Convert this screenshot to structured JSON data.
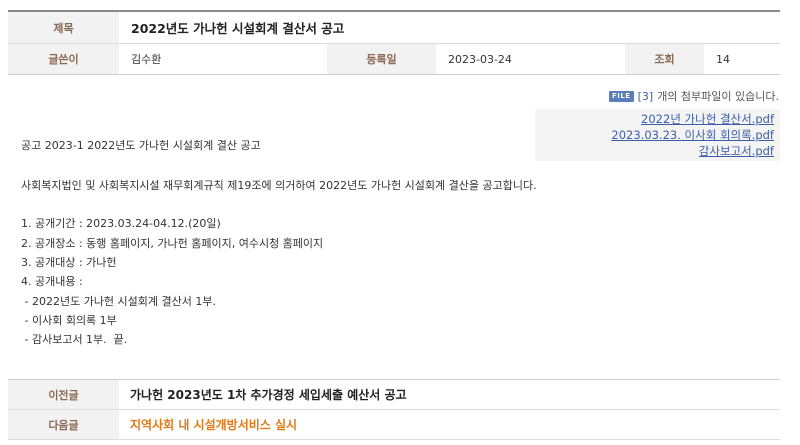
{
  "meta": {
    "title_label": "제목",
    "title": "2022년도 가나헌 시설회계 결산서 공고",
    "author_label": "글쓴이",
    "author": "김수환",
    "date_label": "등록일",
    "date": "2023-03-24",
    "views_label": "조회",
    "views": "14"
  },
  "attachments": {
    "badge": "FILE",
    "count": "[3]",
    "count_suffix": "개의 첨부파일이 있습니다.",
    "files": [
      "2022년 가나헌 결산서.pdf",
      "2023.03.23. 이사회 회의록.pdf",
      "감사보고서.pdf"
    ]
  },
  "content": {
    "lines": [
      "공고 2023-1 2022년도 가나헌 시설회계 결산 공고",
      "사회복지법인 및 사회복지시설 재무회계규칙 제19조에 의거하여 2022년도 가나헌 시설회계 결산을 공고합니다.",
      "1. 공개기간 : 2023.03.24-04.12.(20일)",
      "2. 공개장소 : 동행 홈페이지, 가나헌 홈페이지, 여수시청 홈페이지",
      "3. 공개대상 : 가나헌",
      "4. 공개내용 :",
      " - 2022년도 가나헌 시설회계 결산서 1부.",
      " - 이사회 회의록 1부",
      " - 감사보고서 1부.  끝."
    ]
  },
  "nav": {
    "prev_label": "이전글",
    "prev_title": "가나헌 2023년도 1차 추가경정 세입세출 예산서 공고",
    "next_label": "다음글",
    "next_title": "지역사회 내 시설개방서비스 실시"
  },
  "colors": {
    "label_bg": "#f2f2f2",
    "label_text": "#8a6a55",
    "link": "#3a5ea8",
    "next_title": "#e07a1a"
  }
}
